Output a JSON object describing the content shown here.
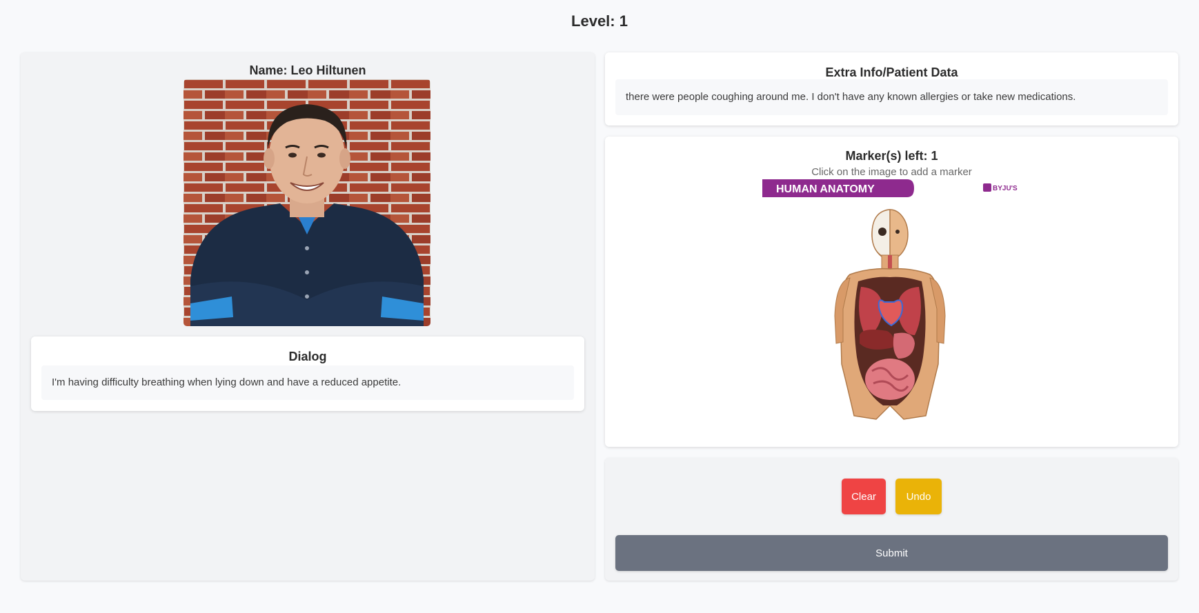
{
  "header": {
    "level_label": "Level: 1"
  },
  "patient": {
    "name_label": "Name: Leo Hiltunen"
  },
  "dialog": {
    "title": "Dialog",
    "text": "I'm having difficulty breathing when lying down and have a reduced appetite."
  },
  "extra_info": {
    "title": "Extra Info/Patient Data",
    "text": "there were people coughing around me. I don't have any known allergies or take new medications."
  },
  "anatomy": {
    "markers_label": "Marker(s) left: 1",
    "hint": "Click on the image to add a marker",
    "banner_text": "HUMAN ANATOMY",
    "brand_text": "BYJU'S"
  },
  "controls": {
    "clear_label": "Clear",
    "undo_label": "Undo",
    "submit_label": "Submit"
  },
  "colors": {
    "clear": "#ef4444",
    "undo": "#eab308",
    "submit": "#6b7280",
    "banner": "#8e2a8e"
  }
}
